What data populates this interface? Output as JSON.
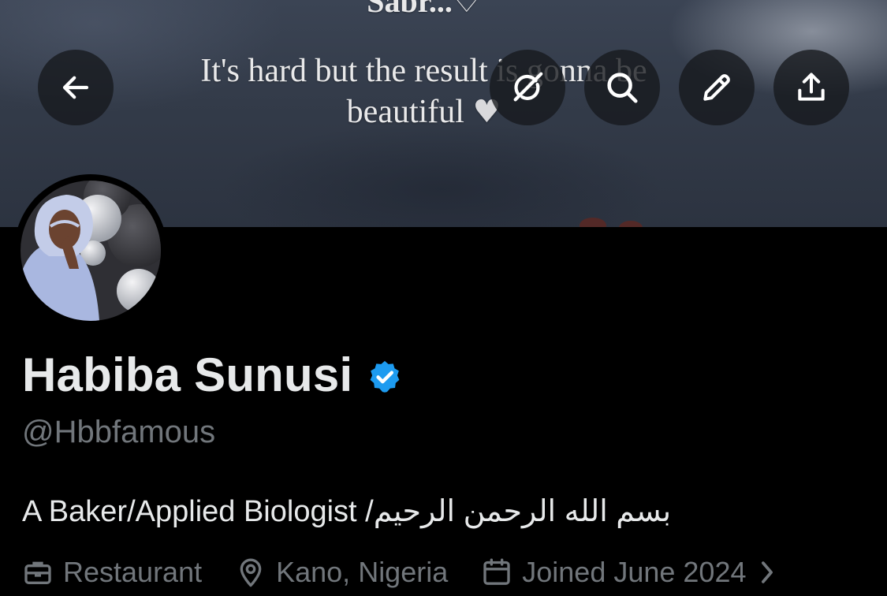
{
  "banner": {
    "line0": "Sabr...",
    "line0_symbol": "♡",
    "line1": "It's hard but the result is gonna be",
    "line2": "beautiful",
    "heart_symbol": "♥"
  },
  "toolbar": {
    "back_icon": "arrow-left-icon",
    "grok_icon": "grok-icon",
    "search_icon": "search-icon",
    "edit_icon": "pencil-icon",
    "share_icon": "share-icon",
    "button_background": "#16181c"
  },
  "profile": {
    "display_name": "Habiba Sunusi",
    "verified_badge_color": "#1d9bf0",
    "handle": "@Hbbfamous",
    "bio_latin": "A Baker/Applied Biologist /",
    "bio_arabic": "بسم الله الرحمن الرحيم",
    "category": "Restaurant",
    "location": "Kano, Nigeria",
    "joined": "Joined June 2024"
  },
  "colors": {
    "background": "#000000",
    "primary_text": "#e7e9ea",
    "secondary_text": "#71767b",
    "accent": "#1d9bf0"
  }
}
